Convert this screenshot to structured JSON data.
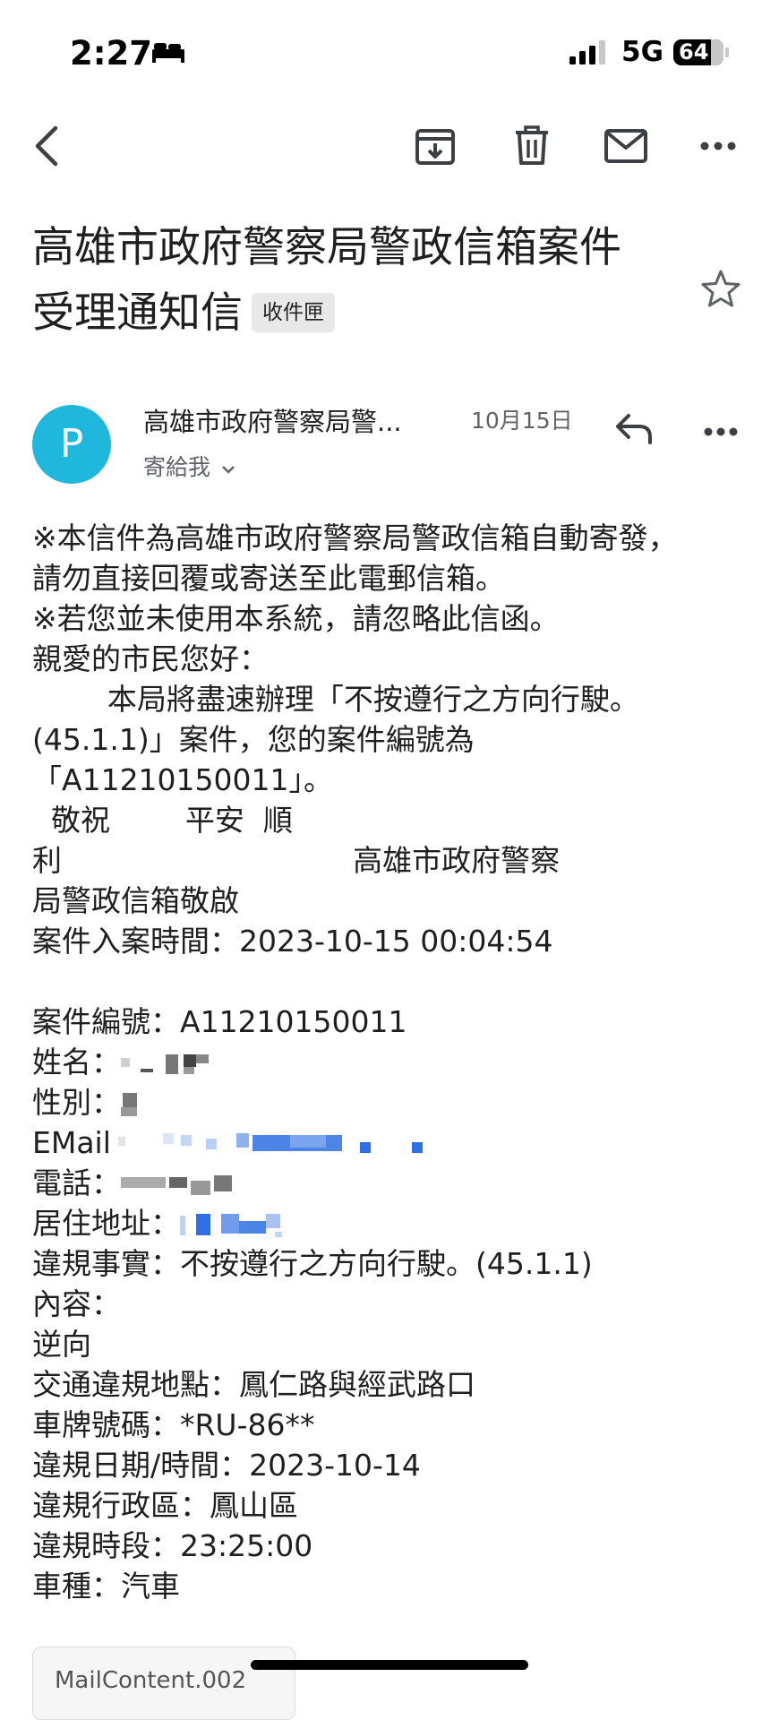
{
  "status_bar": {
    "time": "2:27",
    "network": "5G",
    "battery": "64"
  },
  "toolbar": {
    "icons": [
      "back-arrow-icon",
      "archive-icon",
      "trash-icon",
      "mail-icon",
      "more-icon"
    ]
  },
  "email": {
    "subject_line1": "高雄市政府警察局警政信箱案件",
    "subject_line2": "受理通知信",
    "label": "收件匣",
    "sender_initial": "P",
    "sender_name": "高雄市政府警察局警...",
    "date": "10月15日",
    "to_me": "寄給我"
  },
  "body": {
    "l1": "※本信件為高雄市政府警察局警政信箱自動寄發，",
    "l2": "請勿直接回覆或寄送至此電郵信箱。",
    "l3": "※若您並未使用本系統，請忽略此信函。",
    "l4": "親愛的市民您好：",
    "l5": "        本局將盡速辦理「不按遵行之方向行駛。",
    "l6": "(45.1.1)」案件，您的案件編號為",
    "l7": "「A11210150011」。",
    "l8": "  敬祝        平安  順",
    "l9": "利                               高雄市政府警察",
    "l10": "局警政信箱敬啟",
    "l11": "案件入案時間：2023-10-15 00:04:54",
    "l12": "案件編號：A11210150011",
    "l13": "姓名：",
    "l14": "性別：",
    "l15": "EMail",
    "l16": "電話：",
    "l17": "居住地址：",
    "l18": "違規事實：不按遵行之方向行駛。(45.1.1)",
    "l19": "內容：",
    "l20": "逆向",
    "l21": "交通違規地點：鳳仁路與經武路口",
    "l22": "車牌號碼：*RU-86**",
    "l23": "違規日期/時間：2023-10-14",
    "l24": "違規行政區：鳳山區",
    "l25": "違規時段：23:25:00",
    "l26": "車種：汽車"
  },
  "attachment": {
    "name": "MailContent.002"
  }
}
